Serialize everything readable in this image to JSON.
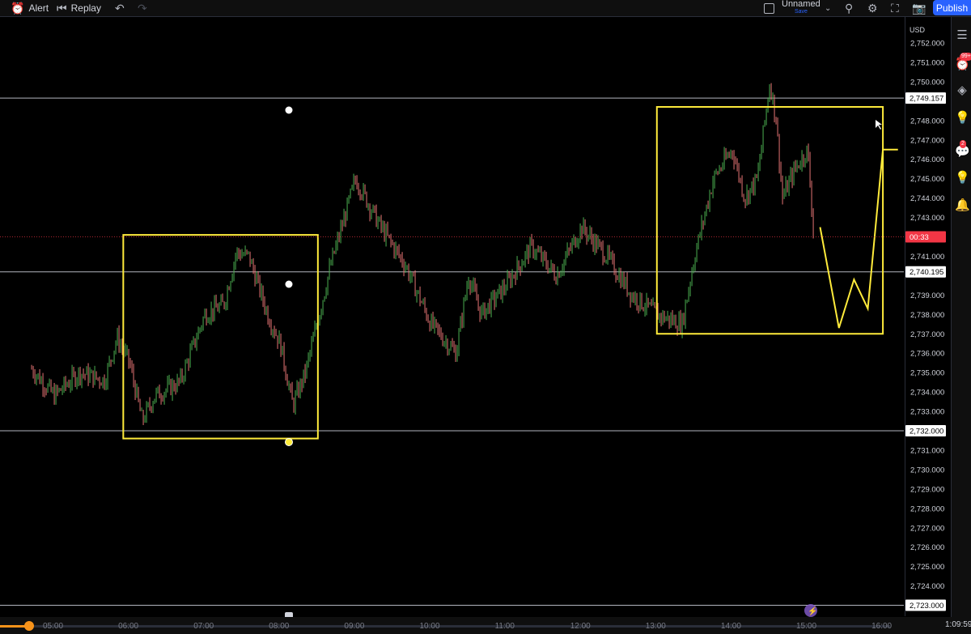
{
  "toolbar": {
    "alert_label": "Alert",
    "replay_label": "Replay",
    "layout_name": "Unnamed",
    "layout_status": "Save",
    "publish_label": "Publish"
  },
  "price_axis": {
    "currency": "USD",
    "ticks": [
      "2,752.000",
      "2,751.000",
      "2,750.000",
      "2,748.000",
      "2,747.000",
      "2,746.000",
      "2,745.000",
      "2,744.000",
      "2,743.000",
      "2,741.000",
      "2,739.000",
      "2,738.000",
      "2,737.000",
      "2,736.000",
      "2,735.000",
      "2,734.000",
      "2,733.000",
      "2,731.000",
      "2,730.000",
      "2,729.000",
      "2,728.000",
      "2,727.000",
      "2,726.000",
      "2,725.000",
      "2,724.000"
    ],
    "tick_values": [
      2752,
      2751,
      2750,
      2748,
      2747,
      2746,
      2745,
      2744,
      2743,
      2741,
      2739,
      2738,
      2737,
      2736,
      2735,
      2734,
      2733,
      2731,
      2730,
      2729,
      2728,
      2727,
      2726,
      2725,
      2724
    ],
    "line_labels": [
      {
        "value": 2749.157,
        "text": "2,749.157"
      },
      {
        "value": 2740.195,
        "text": "2,740.195"
      },
      {
        "value": 2732.0,
        "text": "2,732.000"
      },
      {
        "value": 2723.0,
        "text": "2,723.000"
      }
    ],
    "last_price_value": 2742.0,
    "countdown": "00:33"
  },
  "time_axis": {
    "labels": [
      "05:00",
      "06:00",
      "07:00",
      "08:00",
      "09:00",
      "10:00",
      "11:00",
      "12:00",
      "13:00",
      "14:00",
      "15:00",
      "16:00"
    ],
    "clock": "1:09:59"
  },
  "chart_data": {
    "type": "line",
    "ylim": [
      2722.5,
      2752.5
    ],
    "xlim": [
      "04:42",
      "16:30"
    ],
    "series": [
      {
        "x": [
          "04:42",
          "05:00",
          "05:20",
          "05:40",
          "05:50",
          "06:00",
          "06:10",
          "06:20",
          "06:40",
          "07:00",
          "07:15",
          "07:25",
          "07:35",
          "07:50",
          "08:00",
          "08:10",
          "08:20",
          "08:40",
          "09:00",
          "09:20",
          "09:40",
          "10:00",
          "10:20",
          "10:30",
          "10:40",
          "11:00",
          "11:20",
          "11:40",
          "12:00",
          "12:20",
          "12:40",
          "13:00",
          "13:20",
          "13:30",
          "13:45",
          "14:00",
          "14:10",
          "14:20",
          "14:30",
          "14:35",
          "14:40",
          "14:50",
          "15:00",
          "15:05"
        ],
        "values": [
          2735.2,
          2733.8,
          2735.0,
          2734.6,
          2736.8,
          2735.5,
          2732.5,
          2733.8,
          2734.5,
          2738.0,
          2738.5,
          2741.2,
          2741.0,
          2738.0,
          2736.5,
          2733.3,
          2735.0,
          2740.5,
          2745.0,
          2742.5,
          2740.5,
          2737.5,
          2736.0,
          2740.0,
          2738.0,
          2739.5,
          2741.5,
          2740.0,
          2742.5,
          2741.0,
          2739.0,
          2738.0,
          2737.5,
          2741.0,
          2745.0,
          2746.5,
          2744.0,
          2745.0,
          2750.0,
          2748.0,
          2744.0,
          2745.5,
          2746.5,
          2742.0
        ]
      }
    ],
    "horizontal_lines": [
      2749.157,
      2740.195,
      2732.0,
      2723.0
    ],
    "boxes": [
      {
        "x0": "05:55",
        "x1": "08:30",
        "y0": 2731.6,
        "y1": 2742.1
      },
      {
        "x0": "13:00",
        "x1": "16:00",
        "y0": 2737.0,
        "y1": 2748.7
      }
    ],
    "projection": {
      "x": [
        "15:10",
        "15:25",
        "15:37",
        "15:48",
        "16:00",
        "16:12"
      ],
      "values": [
        2742.5,
        2737.3,
        2739.8,
        2738.3,
        2746.5,
        2746.5
      ]
    },
    "colors": {
      "up": "#4caf50",
      "down": "#e57373",
      "drawing": "#ffeb3b",
      "line": "#b2b5be"
    }
  }
}
